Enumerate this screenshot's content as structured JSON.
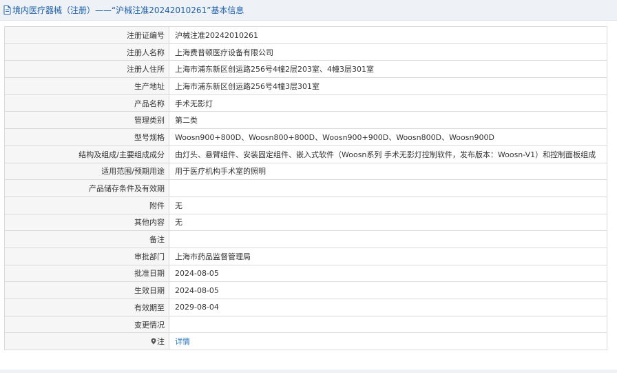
{
  "header": {
    "title": "境内医疗器械（注册）——“沪械注准20242010261”基本信息"
  },
  "rows": [
    {
      "label": "注册证编号",
      "value": "沪械注准20242010261"
    },
    {
      "label": "注册人名称",
      "value": "上海费普顿医疗设备有限公司"
    },
    {
      "label": "注册人住所",
      "value": "上海市浦东新区创运路256号4幢2层203室、4幢3层301室"
    },
    {
      "label": "生产地址",
      "value": "上海市浦东新区创运路256号4幢3层301室"
    },
    {
      "label": "产品名称",
      "value": "手术无影灯"
    },
    {
      "label": "管理类别",
      "value": "第二类"
    },
    {
      "label": "型号规格",
      "value": "Woosn900+800D、Woosn800+800D、Woosn900+900D、Woosn800D、Woosn900D"
    },
    {
      "label": "结构及组成/主要组成成分",
      "value": "由灯头、悬臂组件、安装固定组件、嵌入式软件（Woosn系列 手术无影灯控制软件，发布版本：Woosn-V1）和控制面板组成"
    },
    {
      "label": "适用范围/预期用途",
      "value": "用于医疗机构手术室的照明"
    },
    {
      "label": "产品储存条件及有效期",
      "value": ""
    },
    {
      "label": "附件",
      "value": "无"
    },
    {
      "label": "其他内容",
      "value": "无"
    },
    {
      "label": "备注",
      "value": ""
    },
    {
      "label": "审批部门",
      "value": "上海市药品监督管理局"
    },
    {
      "label": "批准日期",
      "value": "2024-08-05"
    },
    {
      "label": "生效日期",
      "value": "2024-08-05"
    },
    {
      "label": "有效期至",
      "value": "2029-08-04"
    },
    {
      "label": "变更情况",
      "value": ""
    }
  ],
  "note_row": {
    "label": "注",
    "link": "详情"
  },
  "icons": {
    "header": "document-icon",
    "note": "pin-icon"
  },
  "colors": {
    "header_text": "#1a5fa8",
    "link": "#2a7ac0",
    "label_bg": "#f6f6f6"
  }
}
